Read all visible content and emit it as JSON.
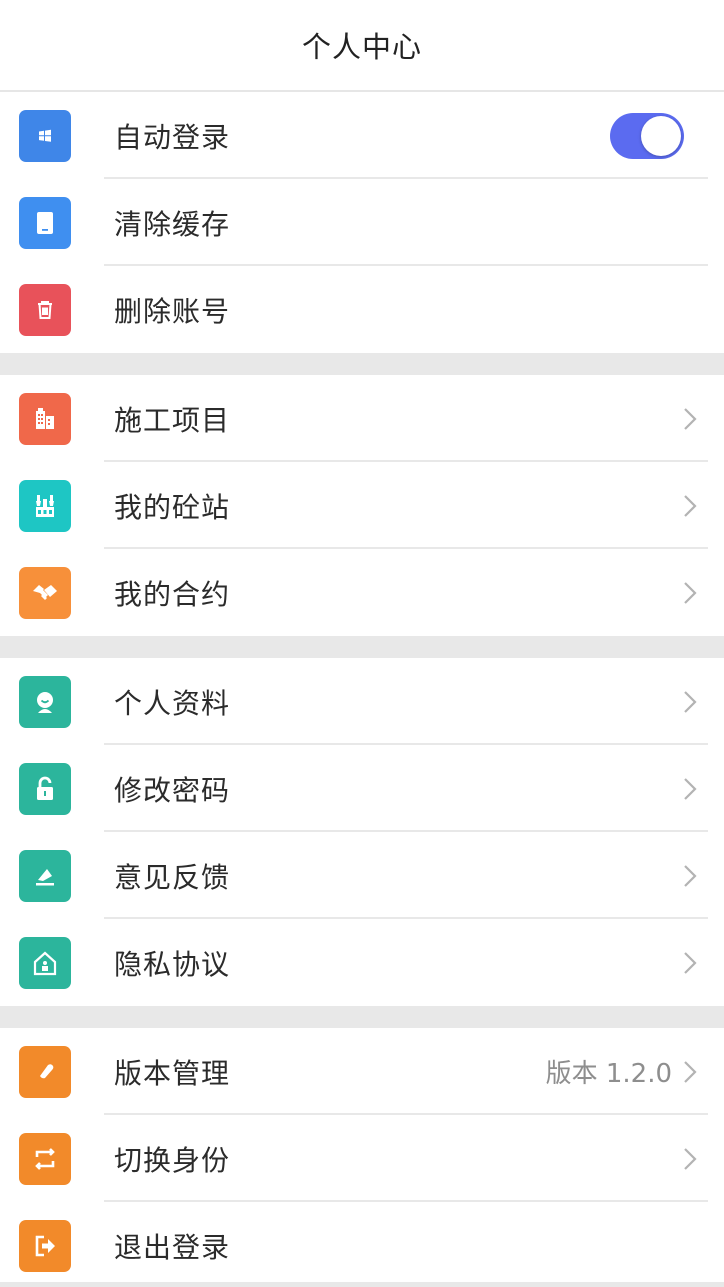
{
  "header": {
    "title": "个人中心"
  },
  "settings": {
    "auto_login": {
      "label": "自动登录",
      "icon": "windows-icon",
      "color": "#3f86e8",
      "enabled": true
    },
    "clear_cache": {
      "label": "清除缓存",
      "icon": "tablet-icon",
      "color": "#3f8ff0"
    },
    "delete_account": {
      "label": "删除账号",
      "icon": "trash-icon",
      "color": "#e8525a"
    }
  },
  "business": {
    "projects": {
      "label": "施工项目",
      "icon": "building-icon",
      "color": "#f0684a"
    },
    "stations": {
      "label": "我的砼站",
      "icon": "concrete-plant-icon",
      "color": "#1ec6c4"
    },
    "contracts": {
      "label": "我的合约",
      "icon": "handshake-icon",
      "color": "#f7903a"
    }
  },
  "account": {
    "profile": {
      "label": "个人资料",
      "icon": "user-icon",
      "color": "#2cb59c"
    },
    "password": {
      "label": "修改密码",
      "icon": "lock-icon",
      "color": "#2cb59c"
    },
    "feedback": {
      "label": "意见反馈",
      "icon": "feedback-icon",
      "color": "#2cb59c"
    },
    "privacy": {
      "label": "隐私协议",
      "icon": "house-icon",
      "color": "#2cb59c"
    }
  },
  "system": {
    "version": {
      "label": "版本管理",
      "value": "版本 1.2.0",
      "icon": "tag-icon",
      "color": "#f28a2a"
    },
    "switch_role": {
      "label": "切换身份",
      "icon": "switch-icon",
      "color": "#f28a2a"
    },
    "logout": {
      "label": "退出登录",
      "icon": "logout-icon",
      "color": "#f28a2a"
    }
  },
  "colors": {
    "toggle_on": "#5b6bf0",
    "divider": "#e8e8e8",
    "chevron": "#b3b3b3"
  }
}
